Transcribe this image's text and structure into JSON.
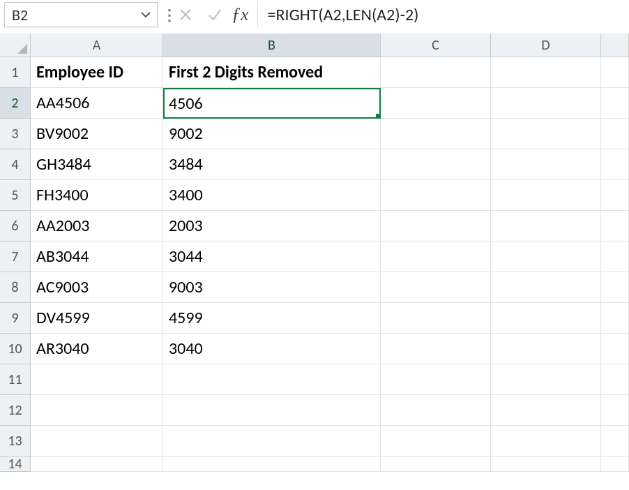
{
  "namebox": {
    "value": "B2"
  },
  "formula_bar": {
    "formula": "=RIGHT(A2,LEN(A2)-2)"
  },
  "columns": {
    "A": "A",
    "B": "B",
    "C": "C",
    "D": "D"
  },
  "rows_visible": [
    "1",
    "2",
    "3",
    "4",
    "5",
    "6",
    "7",
    "8",
    "9",
    "10",
    "11",
    "12",
    "13",
    "14"
  ],
  "active_cell": "B2",
  "headers": {
    "A": "Employee ID",
    "B": "First 2 Digits Removed"
  },
  "data": [
    {
      "A": "AA4506",
      "B": "4506"
    },
    {
      "A": "BV9002",
      "B": "9002"
    },
    {
      "A": "GH3484",
      "B": "3484"
    },
    {
      "A": "FH3400",
      "B": "3400"
    },
    {
      "A": "AA2003",
      "B": "2003"
    },
    {
      "A": "AB3044",
      "B": "3044"
    },
    {
      "A": "AC9003",
      "B": "9003"
    },
    {
      "A": "DV4599",
      "B": "4599"
    },
    {
      "A": "AR3040",
      "B": "3040"
    }
  ]
}
